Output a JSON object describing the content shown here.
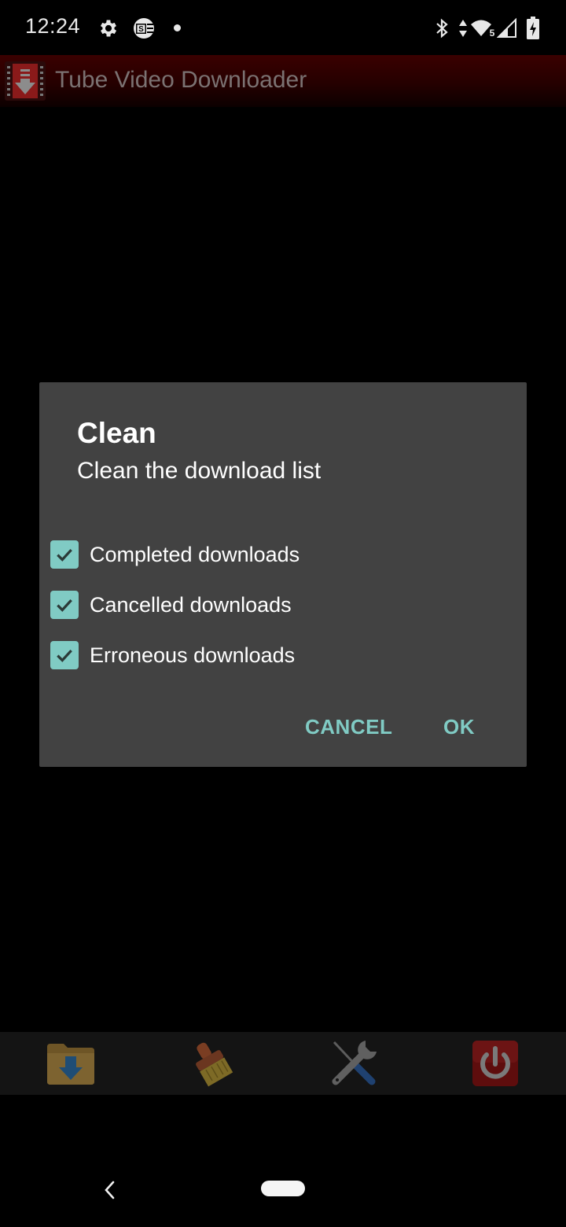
{
  "status_bar": {
    "time": "12:24",
    "left_icons": [
      "settings-gear-icon",
      "sf-app-icon",
      "notification-dot-icon"
    ],
    "right_icons": [
      "bluetooth-icon",
      "data-activity-icon",
      "wifi-icon",
      "cell-signal-icon",
      "battery-charging-icon"
    ],
    "wifi_badge": "5"
  },
  "action_bar": {
    "app_icon": "video-download-icon",
    "title": "Tube Video Downloader"
  },
  "dialog": {
    "title": "Clean",
    "subtitle": "Clean the download list",
    "options": [
      {
        "label": "Completed downloads",
        "checked": true
      },
      {
        "label": "Cancelled downloads",
        "checked": true
      },
      {
        "label": "Erroneous downloads",
        "checked": true
      }
    ],
    "cancel_label": "CANCEL",
    "ok_label": "OK",
    "accent_color": "#80cbc4",
    "background_color": "#424242"
  },
  "toolbar": {
    "items": [
      {
        "name": "downloads-folder",
        "icon": "folder-download-icon"
      },
      {
        "name": "clean",
        "icon": "broom-brush-icon"
      },
      {
        "name": "settings",
        "icon": "tools-icon"
      },
      {
        "name": "exit",
        "icon": "power-icon"
      }
    ]
  },
  "nav_bar": {
    "back_icon": "back-chevron-icon",
    "home_icon": "home-pill-icon"
  }
}
